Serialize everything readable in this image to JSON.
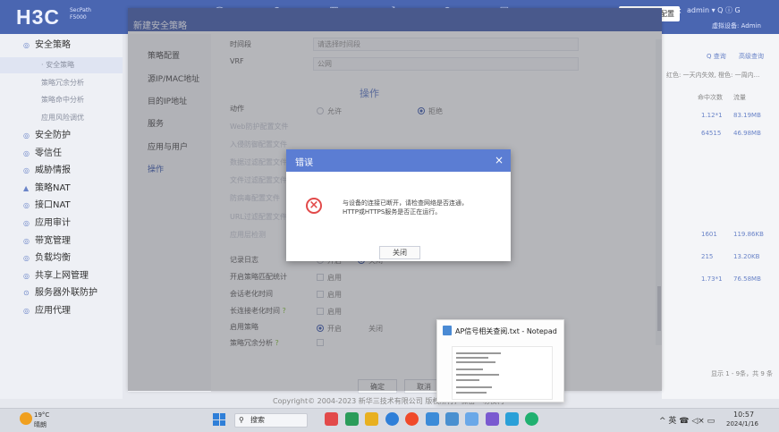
{
  "header": {
    "logo": "H3C",
    "product_line1": "SecPath",
    "product_line2": "F5000",
    "notice": "请及时保存配置",
    "user_info": "admin ▾ Q ⓘ G",
    "sub_user": "虚拟设备: Admin"
  },
  "sidebar": {
    "items": [
      {
        "label": "安全策略",
        "icon": "◎"
      },
      {
        "label": "· 安全策略",
        "sub": true,
        "active": true
      },
      {
        "label": "策略冗余分析",
        "sub": true
      },
      {
        "label": "策略命中分析",
        "sub": true
      },
      {
        "label": "应用风险调优",
        "sub": true
      },
      {
        "label": "安全防护",
        "icon": "◎"
      },
      {
        "label": "零信任",
        "icon": "◎"
      },
      {
        "label": "威胁情报",
        "icon": "◎"
      },
      {
        "label": "策略NAT",
        "icon": "▲"
      },
      {
        "label": "接口NAT",
        "icon": "◎"
      },
      {
        "label": "应用审计",
        "icon": "◎"
      },
      {
        "label": "带宽管理",
        "icon": "◎"
      },
      {
        "label": "负载均衡",
        "icon": "◎"
      },
      {
        "label": "共享上网管理",
        "icon": "◎"
      },
      {
        "label": "服务器外联防护",
        "icon": "⊙"
      },
      {
        "label": "应用代理",
        "icon": "◎"
      }
    ]
  },
  "dialog": {
    "title": "新建安全策略",
    "tabs": [
      "策略配置",
      "源IP/MAC地址",
      "目的IP地址",
      "服务",
      "应用与用户",
      "操作"
    ],
    "time_label": "时间段",
    "time_placeholder": "请选择时间段",
    "vrf_label": "VRF",
    "vrf_value": "公网",
    "section_action": "操作",
    "action_label": "动作",
    "action_allow": "允许",
    "action_deny": "拒绝",
    "log_label": "记录日志",
    "log_on": "开启",
    "log_off": "关闭",
    "stat_label": "开启策略匹配统计",
    "stat_value": "启用",
    "session_label": "会话老化时间",
    "session_value": "启用",
    "long_label": "长连接老化时间",
    "long_value": "启用",
    "enable_label": "启用策略",
    "enable_on": "开启",
    "enable_off": "关闭",
    "redundancy_label": "策略冗余分析",
    "ok_label": "确定",
    "cancel_label": "取消"
  },
  "error_dialog": {
    "title": "错误",
    "message_line1": "与设备的连接已断开，请检查网络是否连通，",
    "message_line2": "HTTP或HTTPS服务是否正在运行。",
    "button": "关闭"
  },
  "right_panel": {
    "query": "Q 查询",
    "advanced": "高级查询",
    "legend": "红色: 一天内失效, 橙色: 一周内...",
    "col_hits": "命中次数",
    "col_flow": "流量",
    "rows": [
      {
        "hits": "1.12*1",
        "flow": "83.19MB"
      },
      {
        "hits": "64515",
        "flow": "46.98MB"
      },
      {
        "hits": "1601",
        "flow": "119.86KB"
      },
      {
        "hits": "215",
        "flow": "13.20KB"
      },
      {
        "hits": "1.73*1",
        "flow": "76.58MB"
      }
    ],
    "pager": "显示 1 - 9条，共 9 条"
  },
  "footer": {
    "copyright": "Copyright© 2004-2023 新华三技术有限公司 版权所有，保留一切权利"
  },
  "notepad_preview": {
    "title": "AP信号相关查阅.txt - Notepad"
  },
  "taskbar": {
    "temperature": "19°C",
    "weather": "晴朗",
    "search": "搜索",
    "tray": "^ 英 ☎ ◁× ▭",
    "time": "10:57",
    "date": "2024/1/16"
  },
  "colors": {
    "header": "#4a66b1",
    "error_header": "#5b7dd3",
    "error_icon": "#e24a4a"
  }
}
